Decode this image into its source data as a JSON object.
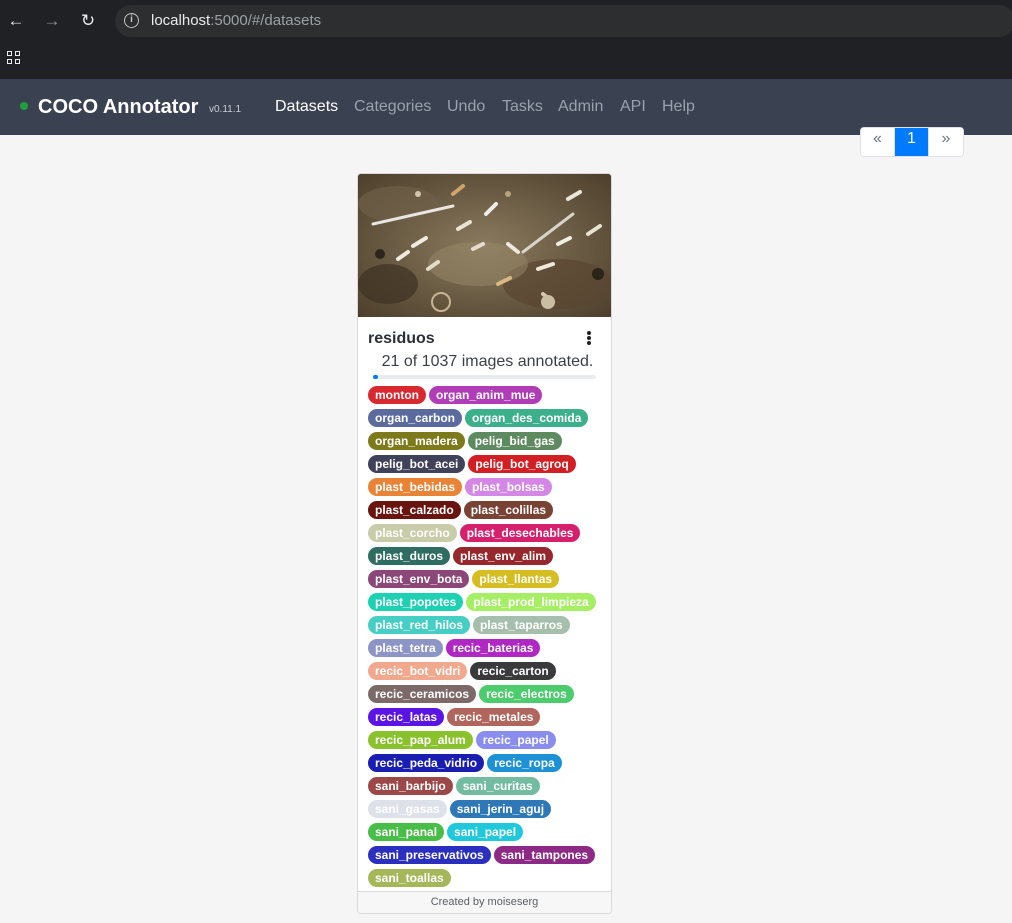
{
  "browser": {
    "url_host": "localhost",
    "url_path": ":5000/#/datasets"
  },
  "navbar": {
    "brand": "COCO Annotator",
    "version": "v0.11.1",
    "links": [
      "Datasets",
      "Categories",
      "Undo",
      "Tasks",
      "Admin",
      "API",
      "Help"
    ],
    "active": "Datasets"
  },
  "pagination": {
    "prev": "«",
    "current": "1",
    "next": "»"
  },
  "dataset": {
    "name": "residuos",
    "annotated_text": "21 of 1037 images annotated.",
    "annotated_count": 21,
    "total_images": 1037,
    "created_by": "Created by moiseserg",
    "categories": [
      {
        "name": "monton",
        "color": "#d9282f"
      },
      {
        "name": "organ_anim_mue",
        "color": "#b13cb8"
      },
      {
        "name": "organ_carbon",
        "color": "#5b6b9e"
      },
      {
        "name": "organ_des_comida",
        "color": "#3bb08a"
      },
      {
        "name": "organ_madera",
        "color": "#7d7a1c"
      },
      {
        "name": "pelig_bid_gas",
        "color": "#5e8a5f"
      },
      {
        "name": "pelig_bot_acei",
        "color": "#3f4259"
      },
      {
        "name": "pelig_bot_agroq",
        "color": "#d11f23"
      },
      {
        "name": "plast_bebidas",
        "color": "#e98437"
      },
      {
        "name": "plast_bolsas",
        "color": "#d587e8"
      },
      {
        "name": "plast_calzado",
        "color": "#6a1410"
      },
      {
        "name": "plast_colillas",
        "color": "#7a4235"
      },
      {
        "name": "plast_corcho",
        "color": "#c9cca8"
      },
      {
        "name": "plast_desechables",
        "color": "#d6206e"
      },
      {
        "name": "plast_duros",
        "color": "#2f6d62"
      },
      {
        "name": "plast_env_alim",
        "color": "#97272c"
      },
      {
        "name": "plast_env_bota",
        "color": "#8b4777"
      },
      {
        "name": "plast_llantas",
        "color": "#d6be22"
      },
      {
        "name": "plast_popotes",
        "color": "#1fd1b2"
      },
      {
        "name": "plast_prod_limpieza",
        "color": "#a6ee64"
      },
      {
        "name": "plast_red_hilos",
        "color": "#45cec3"
      },
      {
        "name": "plast_taparros",
        "color": "#a6bfad"
      },
      {
        "name": "plast_tetra",
        "color": "#8d94c6"
      },
      {
        "name": "recic_baterias",
        "color": "#b028c4"
      },
      {
        "name": "recic_bot_vidri",
        "color": "#f0a98f"
      },
      {
        "name": "recic_carton",
        "color": "#3a393b"
      },
      {
        "name": "recic_ceramicos",
        "color": "#7c6a69"
      },
      {
        "name": "recic_electros",
        "color": "#4ccc6c"
      },
      {
        "name": "recic_latas",
        "color": "#5b14e6"
      },
      {
        "name": "recic_metales",
        "color": "#b0665c"
      },
      {
        "name": "recic_pap_alum",
        "color": "#8ac22d"
      },
      {
        "name": "recic_papel",
        "color": "#8a8ded"
      },
      {
        "name": "recic_peda_vidrio",
        "color": "#1a1db2"
      },
      {
        "name": "recic_ropa",
        "color": "#1d91d5"
      },
      {
        "name": "sani_barbijo",
        "color": "#9c4748"
      },
      {
        "name": "sani_curitas",
        "color": "#73bca2"
      },
      {
        "name": "sani_gasas",
        "color": "#dde2ea"
      },
      {
        "name": "sani_jerin_aguj",
        "color": "#2f78b7"
      },
      {
        "name": "sani_panal",
        "color": "#48bd47"
      },
      {
        "name": "sani_papel",
        "color": "#20c8dc"
      },
      {
        "name": "sani_preservativos",
        "color": "#2a2fbf"
      },
      {
        "name": "sani_tampones",
        "color": "#8d2a86"
      },
      {
        "name": "sani_toallas",
        "color": "#a6b75a"
      }
    ]
  }
}
